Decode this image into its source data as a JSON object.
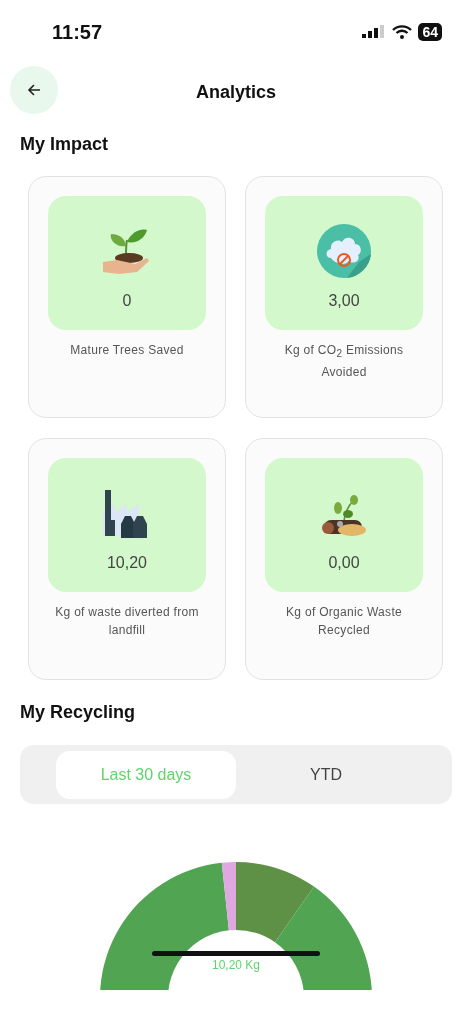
{
  "status_bar": {
    "time": "11:57",
    "battery": "64"
  },
  "header": {
    "title": "Analytics"
  },
  "impact": {
    "title": "My Impact",
    "cards": [
      {
        "kind": "plant",
        "value": "0",
        "label": "Mature Trees Saved"
      },
      {
        "kind": "co2",
        "value": "3,00",
        "label": "Kg of CO$_{2}$ Emissions Avoided"
      },
      {
        "kind": "factory",
        "value": "10,20",
        "label": "Kg of waste diverted from landfill"
      },
      {
        "kind": "organic",
        "value": "0,00",
        "label": "Kg of Organic Waste Recycled"
      }
    ]
  },
  "recycling": {
    "title": "My Recycling",
    "tabs": [
      {
        "label": "Last 30 days",
        "selected": true
      },
      {
        "label": "YTD",
        "selected": false
      }
    ],
    "total": "10,20 Kg"
  }
}
